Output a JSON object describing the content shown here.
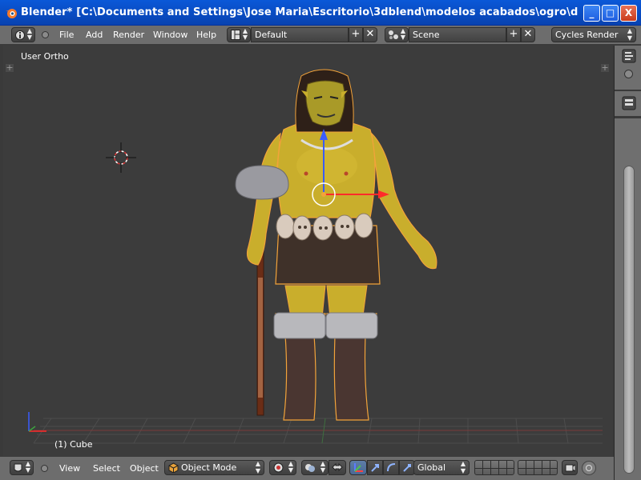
{
  "window": {
    "title": "Blender* [C:\\Documents and Settings\\Jose Maria\\Escritorio\\3dblend\\modelos acabados\\ogro\\definitivos\\acaba...",
    "buttons": [
      "_",
      "□",
      "X"
    ]
  },
  "info_header": {
    "menus": [
      "File",
      "Add",
      "Render",
      "Window",
      "Help"
    ],
    "screen_layout": "Default",
    "scene": "Scene",
    "render_engine": "Cycles Render"
  },
  "viewport": {
    "view_label": "User Ortho",
    "object_label": "(1) Cube"
  },
  "bottom_header": {
    "menus": [
      "View",
      "Select",
      "Object"
    ],
    "mode": "Object Mode",
    "orientation": "Global"
  },
  "colors": {
    "titlebar": "#0842b0",
    "header": "#6d6d6d",
    "viewport_bg": "#3c3c3c",
    "skin": "#c9ae2c",
    "selection_outline": "#f2a33a",
    "axis_x": "#ff2a2a",
    "axis_z": "#3a5cff"
  }
}
